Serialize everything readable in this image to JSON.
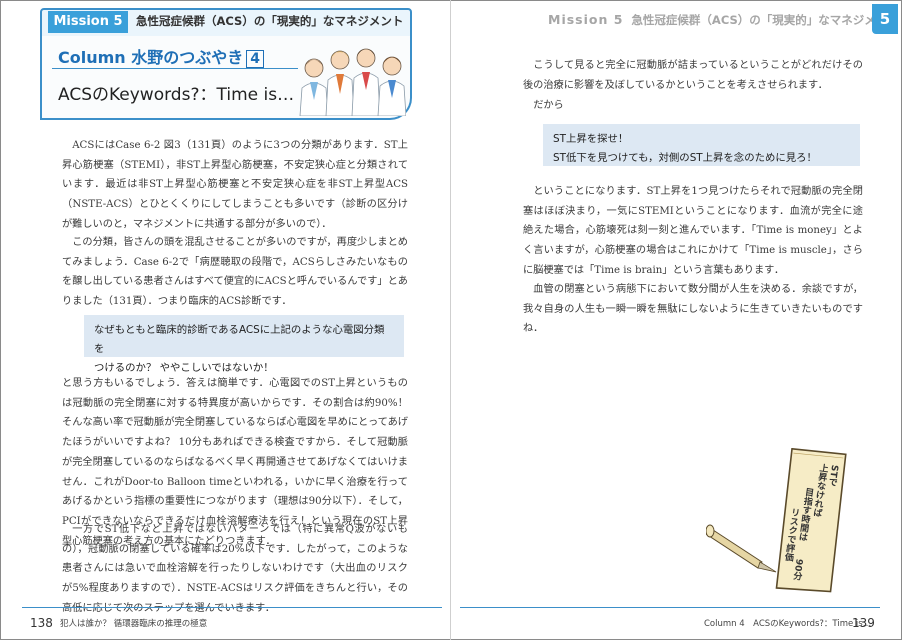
{
  "left_header": {
    "mission": "Mission 5",
    "title": "急性冠症候群（ACS）の「現実的」なマネジメント"
  },
  "column": {
    "title": "Column 水野のつぶやき",
    "number": "4",
    "subtitle": "ACSのKeywords?：Time is…"
  },
  "left_paragraphs": [
    "ACSにはCase 6-2 図3（131頁）のように3つの分類があります．ST上昇心筋梗塞（STEMI），非ST上昇型心筋梗塞，不安定狭心症と分類されています．最近は非ST上昇型心筋梗塞と不安定狭心症を非ST上昇型ACS（NSTE-ACS）とひとくくりにしてしまうことも多いです（診断の区分けが難しいのと，マネジメントに共通する部分が多いので）．",
    "この分類，皆さんの頭を混乱させることが多いのですが，再度少しまとめてみましょう．Case 6-2で「病歴聴取の段階で，ACSらしさみたいなものを醸し出している患者さんはすべて便宜的にACSと呼んでいるんです」とありました（131頁）．つまり臨床的ACS診断です．"
  ],
  "left_callout": {
    "line1": "なぜもともと臨床的診断であるACSに上記のような心電図分類を",
    "line2": "つけるのか？ ややこしいではないか！"
  },
  "left_paragraphs_2": [
    "と思う方もいるでしょう．答えは簡単です．心電図でのST上昇というものは冠動脈の完全閉塞に対する特異度が高いからです．その割合は約90%！ そんな高い率で冠動脈が完全閉塞しているならば心電図を早めにとってあげたほうがいいですよね？ 10分もあればできる検査ですから．そして冠動脈が完全閉塞しているのならばなるべく早く再開通させてあげなくてはいけません．これがDoor-to Balloon timeといわれる，いかに早く治療を行ってあげるかという指標の重要性につながります（理想は90分以下）．そして，PCIができないならできるだけ血栓溶解療法を行え！という現在のST上昇型心筋梗塞の考え方の基本にたどりつきます．",
    "一方でST低下など上昇ではないパターンでは（特に異常Q波がないもの），冠動脈の閉塞している確率は20%以下です．したがって，このような患者さんには急いで血栓溶解を行ったりしないわけです（大出血のリスクが5%程度ありますので）．NSTE-ACSはリスク評価をきちんと行い，その高低に応じて次のステップを選んでいきます．"
  ],
  "right_header": {
    "mission": "Mission 5",
    "title": "急性冠症候群（ACS）の「現実的」なマネジメント",
    "chapter": "5"
  },
  "right_paragraphs": [
    "こうして見ると完全に冠動脈が詰まっているということがどれだけその後の治療に影響を及ぼしているかということを考えさせられます．",
    "だから"
  ],
  "right_callout": {
    "line1": "ST上昇を探せ！",
    "line2": "ST低下を見つけても，対側のST上昇を念のために見ろ！"
  },
  "right_paragraphs_2": [
    "ということになります．ST上昇を1つ見つけたらそれで冠動脈の完全閉塞はほぼ決まり，一気にSTEMIということになります．血流が完全に途絶えた場合，心筋壊死は刻一刻と進んでいます．「Time is money」とよく言いますが，心筋梗塞の場合はこれにかけて「Time is muscle」，さらに脳梗塞では「Time is brain」という言葉もあります．",
    "血管の閉塞という病態下において数分間が人生を決める．余談ですが，我々自身の人生も一瞬一瞬を無駄にしないように生きていきたいものですね．"
  ],
  "scroll_note": {
    "col1": "STで",
    "col2": "上昇なければ",
    "col3": "目指す時間は",
    "col4": "リスクで評価",
    "col5": "90分"
  },
  "footer": {
    "left_page": "138",
    "left_text": "犯人は誰か？ 循環器臨床の推理の極意",
    "right_text": "Column 4　ACSのKeywords?：Time is…",
    "right_page": "139"
  },
  "colors": {
    "accent": "#3aa0da",
    "callout_bg": "#dde8f3",
    "scroll": "#f4ebc6"
  }
}
